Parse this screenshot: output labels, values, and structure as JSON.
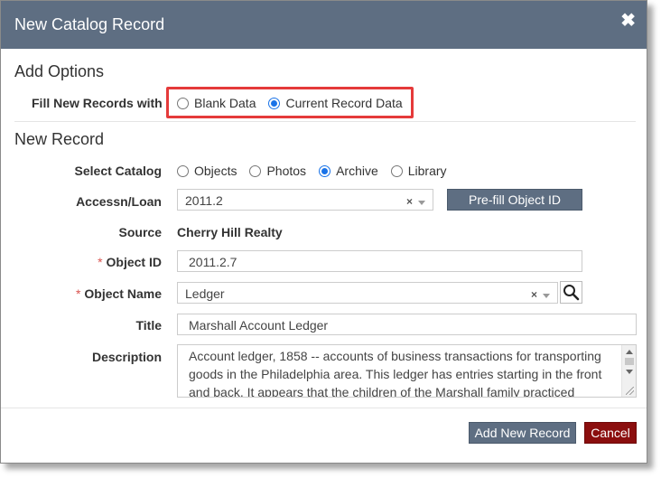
{
  "dialog": {
    "title": "New Catalog Record",
    "close_glyph": "✖"
  },
  "add_options": {
    "heading": "Add Options",
    "fill_label": "Fill New Records with",
    "options": [
      {
        "label": "Blank Data",
        "checked": false
      },
      {
        "label": "Current Record Data",
        "checked": true
      }
    ],
    "highlight_color": "#e53a3a"
  },
  "new_record": {
    "heading": "New Record",
    "select_catalog": {
      "label": "Select Catalog",
      "options": [
        {
          "label": "Objects",
          "checked": false
        },
        {
          "label": "Photos",
          "checked": false
        },
        {
          "label": "Archive",
          "checked": true
        },
        {
          "label": "Library",
          "checked": false
        }
      ]
    },
    "accession": {
      "label": "Accessn/Loan",
      "value": "2011.2",
      "clear_glyph": "×",
      "prefill_button": "Pre-fill Object ID"
    },
    "source": {
      "label": "Source",
      "value": "Cherry Hill Realty"
    },
    "object_id": {
      "required_mark": "*",
      "label": "Object ID",
      "value": "2011.2.7"
    },
    "object_name": {
      "required_mark": "*",
      "label": "Object Name",
      "value": "Ledger",
      "clear_glyph": "×"
    },
    "title": {
      "label": "Title",
      "value": "Marshall Account Ledger"
    },
    "description": {
      "label": "Description",
      "value": "Account ledger, 1858 -- accounts of business transactions for transporting goods in the Philadelphia area. This ledger has entries starting in the front and back. It appears that the children of the Marshall family practiced"
    }
  },
  "footer": {
    "add_button": "Add New Record",
    "cancel_button": "Cancel"
  },
  "colors": {
    "titlebar": "#5e6e82",
    "button": "#5e6e82",
    "cancel": "#8b0e0e",
    "radio_accent": "#1a73e8",
    "required": "#d9534f"
  }
}
